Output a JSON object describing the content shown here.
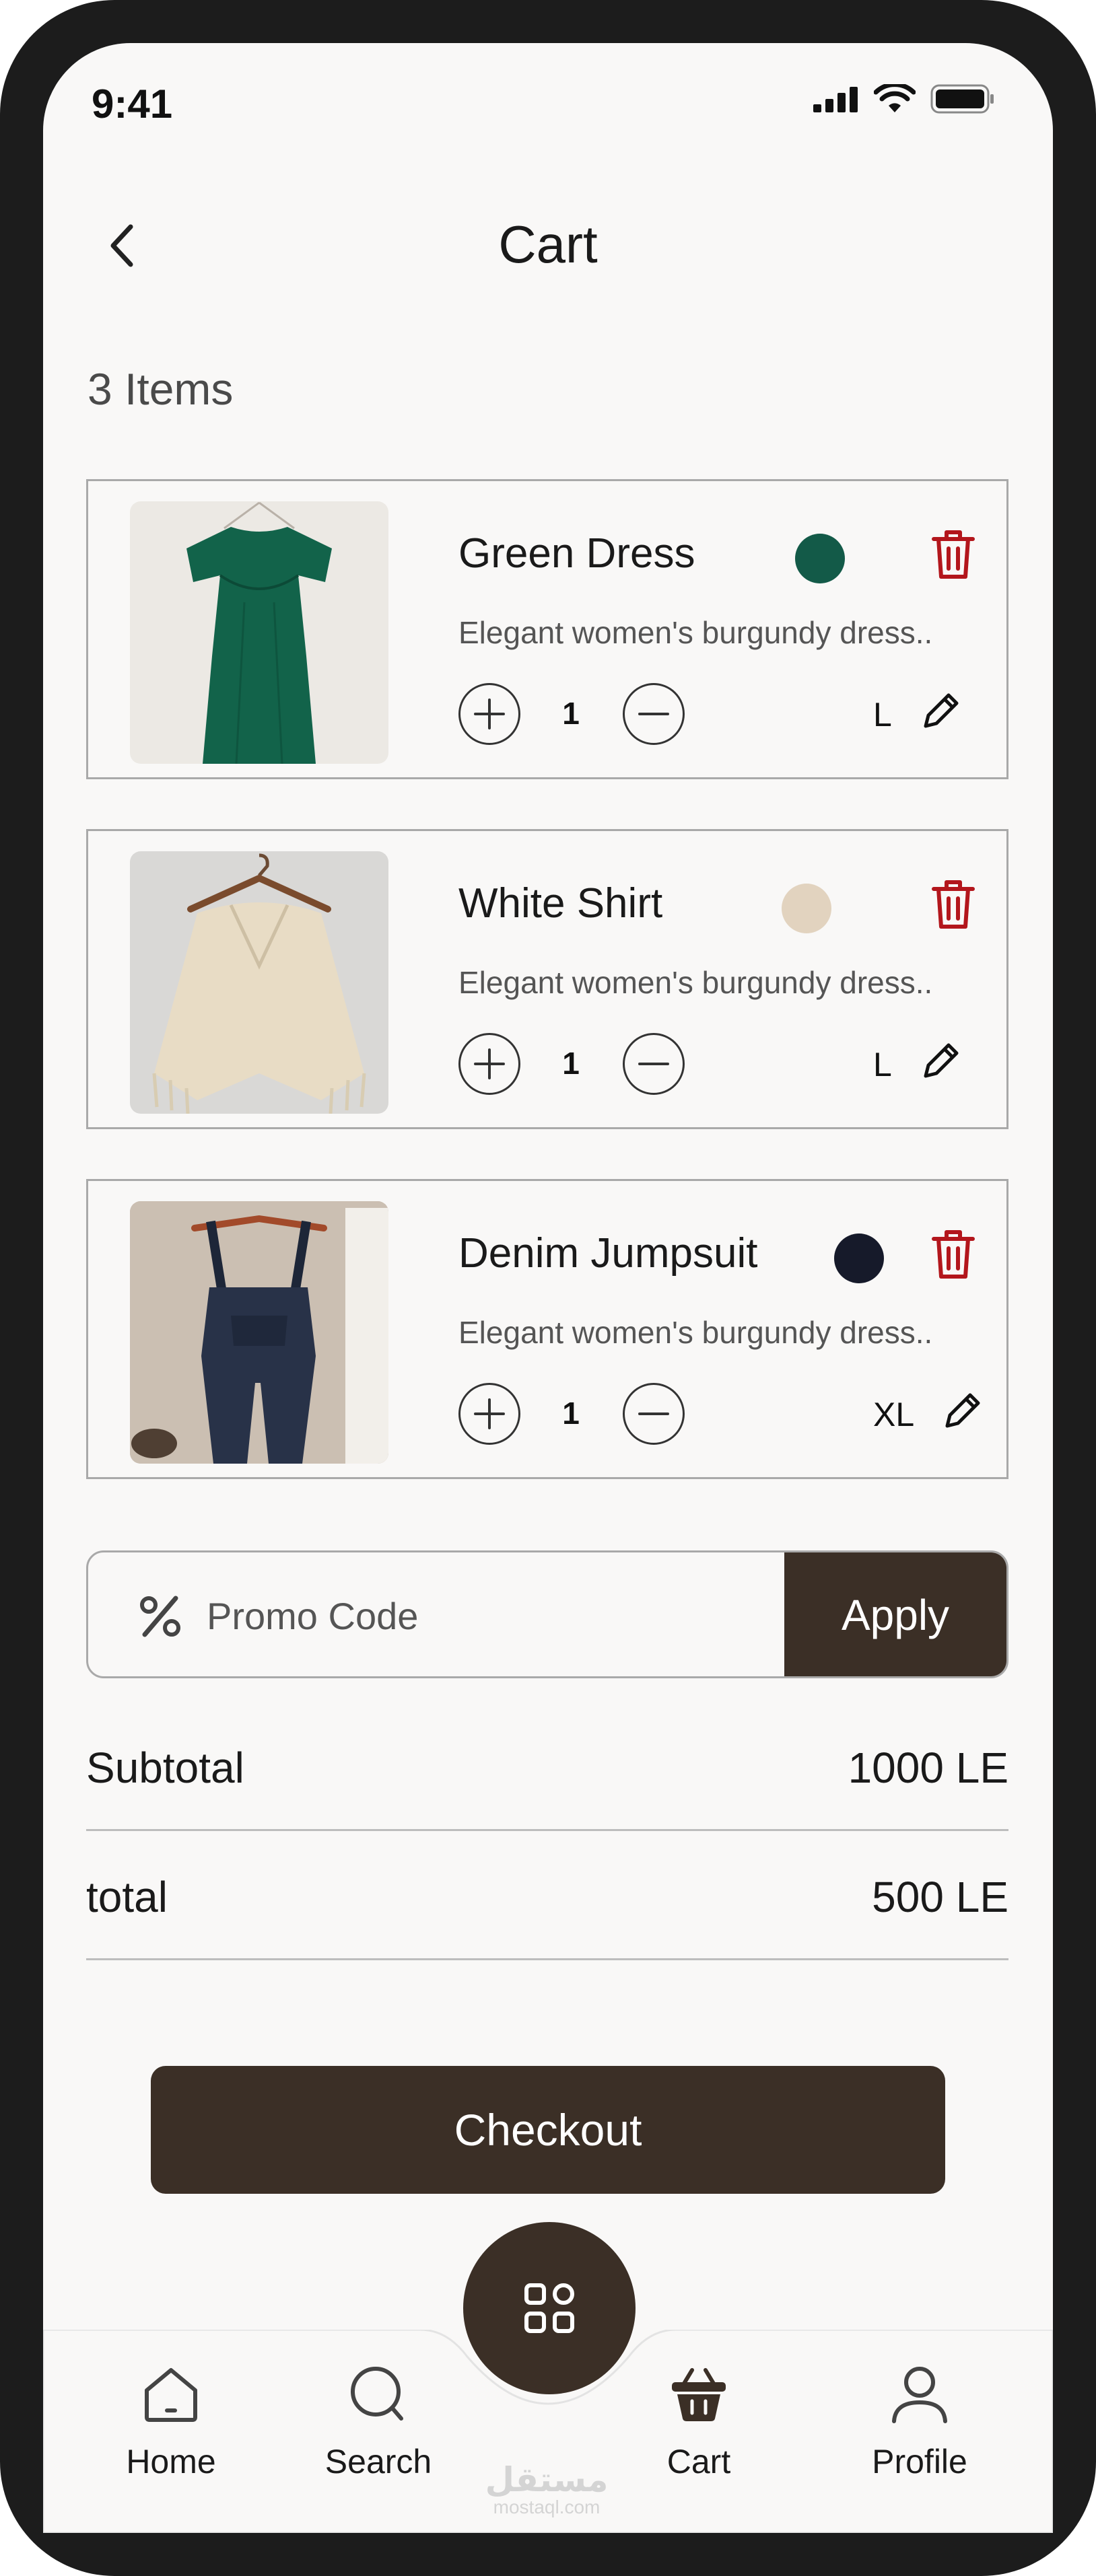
{
  "status_bar": {
    "time": "9:41"
  },
  "header": {
    "title": "Cart"
  },
  "items_count": "3 Items",
  "cart_items": [
    {
      "name": "Green Dress",
      "color": "#135a48",
      "description": "Elegant women's burgundy dress..",
      "quantity": "1",
      "size": "L"
    },
    {
      "name": "White Shirt",
      "color": "#e2d3bf",
      "description": "Elegant women's burgundy dress..",
      "quantity": "1",
      "size": "L"
    },
    {
      "name": "Denim Jumpsuit",
      "color": "#161a2a",
      "description": "Elegant women's burgundy dress..",
      "quantity": "1",
      "size": "XL"
    }
  ],
  "promo": {
    "placeholder": "Promo Code",
    "apply_label": "Apply"
  },
  "summary": {
    "subtotal_label": "Subtotal",
    "subtotal_value": "1000 LE",
    "total_label": "total",
    "total_value": "500 LE"
  },
  "checkout_label": "Checkout",
  "nav": {
    "home": "Home",
    "search": "Search",
    "cart": "Cart",
    "profile": "Profile"
  },
  "watermark": {
    "arabic": "مستقل",
    "latin": "mostaql.com"
  },
  "colors": {
    "accent": "#3b2f26",
    "delete": "#b3161c",
    "background": "#f9f8f7"
  },
  "icons": [
    "back-chevron-icon",
    "trash-icon",
    "plus-icon",
    "minus-icon",
    "pencil-icon",
    "percent-icon",
    "grid-icon",
    "home-icon",
    "search-icon",
    "basket-icon",
    "user-icon"
  ]
}
